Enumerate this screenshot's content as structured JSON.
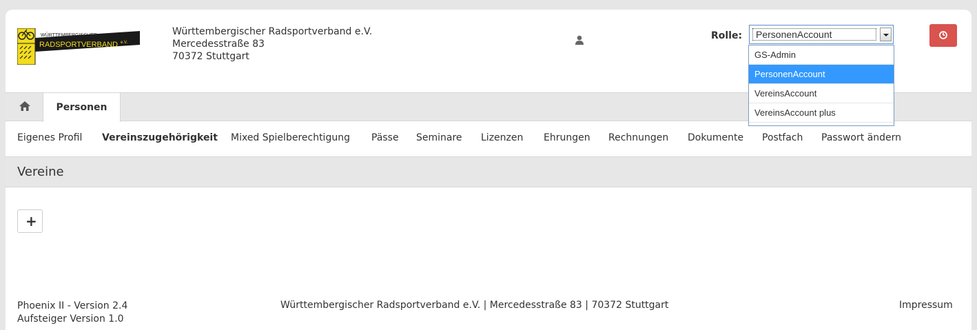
{
  "header": {
    "logo": {
      "line1": "WÜRTTEMBERGISCHER",
      "line2": "RADSPORTVERBAND",
      "suffix": "e.V."
    },
    "address": [
      "Württembergischer Radsportverband e.V.",
      "Mercedesstraße 83",
      "70372 Stuttgart"
    ],
    "role_label": "Rolle:",
    "role_selected": "PersonenAccount",
    "role_options": [
      "GS-Admin",
      "PersonenAccount",
      "VereinsAccount",
      "VereinsAccount plus"
    ],
    "colors": {
      "logout": "#d9534f",
      "selected_option": "#3399ff"
    }
  },
  "tabs": {
    "active": "Personen"
  },
  "subnav": [
    {
      "label": "Eigenes Profil",
      "active": false
    },
    {
      "label": "Vereinszugehörigkeit",
      "active": true
    },
    {
      "label": "Mixed Spielberechtigung",
      "active": false
    },
    {
      "label": "Pässe",
      "active": false
    },
    {
      "label": "Seminare",
      "active": false
    },
    {
      "label": "Lizenzen",
      "active": false
    },
    {
      "label": "Ehrungen",
      "active": false
    },
    {
      "label": "Rechnungen",
      "active": false
    },
    {
      "label": "Dokumente",
      "active": false
    },
    {
      "label": "Postfach",
      "active": false
    },
    {
      "label": "Passwort ändern",
      "active": false
    }
  ],
  "section": {
    "title": "Vereine",
    "add_symbol": "+"
  },
  "footer": {
    "version_lines": [
      "Phoenix II - Version 2.4",
      "Aufsteiger Version 1.0"
    ],
    "center": "Württembergischer Radsportverband e.V. | Mercedesstraße 83 | 70372 Stuttgart",
    "impressum": "Impressum"
  }
}
